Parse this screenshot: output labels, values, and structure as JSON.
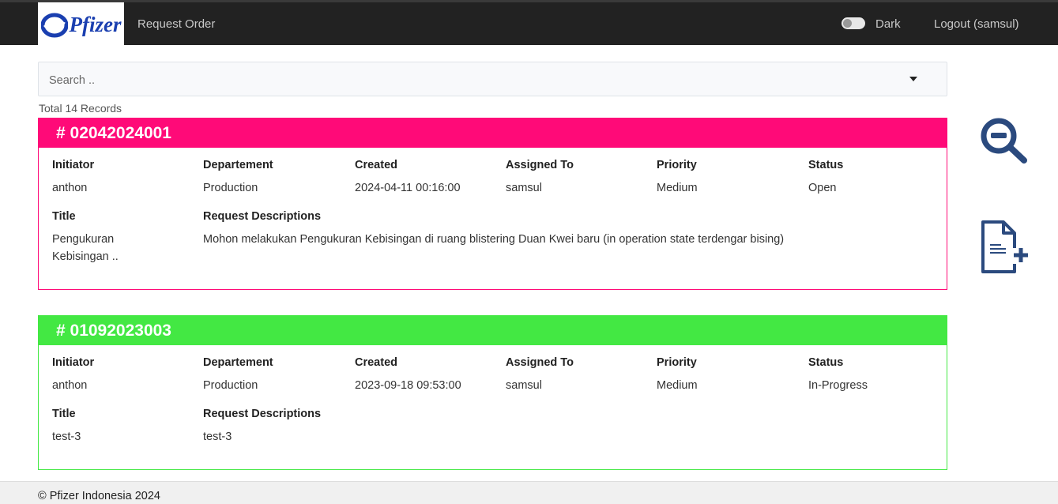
{
  "navbar": {
    "logo_text": "Pfizer",
    "link_request_order": "Request Order",
    "dark_label": "Dark",
    "logout_label": "Logout (samsul)"
  },
  "search": {
    "placeholder": "Search .."
  },
  "total_records": "Total 14 Records",
  "labels": {
    "initiator": "Initiator",
    "department": "Departement",
    "created": "Created",
    "assigned_to": "Assigned To",
    "priority": "Priority",
    "status": "Status",
    "title": "Title",
    "request_descriptions": "Request Descriptions"
  },
  "records": [
    {
      "id": "# 02042024001",
      "header_color": "#ff0a78",
      "border_color": "#ff0a78",
      "initiator": "anthon",
      "department": "Production",
      "created": "2024-04-11 00:16:00",
      "assigned_to": "samsul",
      "priority": "Medium",
      "status": "Open",
      "title_line1": "Pengukuran",
      "title_line2": "Kebisingan ..",
      "description": "Mohon melakukan Pengukuran Kebisingan di ruang blistering Duan Kwei baru (in operation state terdengar bising)"
    },
    {
      "id": "# 01092023003",
      "header_color": "#43e843",
      "border_color": "#43e843",
      "initiator": "anthon",
      "department": "Production",
      "created": "2023-09-18 09:53:00",
      "assigned_to": "samsul",
      "priority": "Medium",
      "status": "In-Progress",
      "title_line1": "test-3",
      "title_line2": "",
      "description": "test-3"
    }
  ],
  "sidebar_actions": {
    "search_icon": "zoom-out-icon",
    "new_doc_icon": "file-add-icon",
    "icon_color": "#2b4a7e"
  },
  "footer": {
    "text": "© Pfizer Indonesia 2024"
  }
}
